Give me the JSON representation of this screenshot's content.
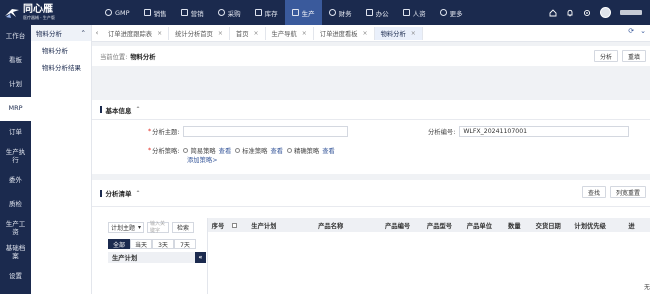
{
  "logo": {
    "title": "同心雁",
    "subtitle": "医疗器械 · 生产版"
  },
  "topnav": {
    "items": [
      {
        "label": "GMP",
        "icon": "settings-icon",
        "active": false
      },
      {
        "label": "销售",
        "icon": "sales-icon",
        "active": false
      },
      {
        "label": "营销",
        "icon": "marketing-icon",
        "active": false
      },
      {
        "label": "采购",
        "icon": "purchase-icon",
        "active": false
      },
      {
        "label": "库存",
        "icon": "inventory-icon",
        "active": false
      },
      {
        "label": "生产",
        "icon": "production-icon",
        "active": true
      },
      {
        "label": "财务",
        "icon": "finance-icon",
        "active": false
      },
      {
        "label": "办公",
        "icon": "office-icon",
        "active": false
      },
      {
        "label": "人资",
        "icon": "hr-icon",
        "active": false
      },
      {
        "label": "更多",
        "icon": "more-icon",
        "active": false
      }
    ]
  },
  "sidebar": {
    "items": [
      {
        "label": "工作台"
      },
      {
        "label": "看板"
      },
      {
        "label": "计划"
      },
      {
        "label": "MRP",
        "active": true
      },
      {
        "label": "订单"
      },
      {
        "label": "生产执行"
      },
      {
        "label": "委外"
      },
      {
        "label": "质检"
      },
      {
        "label": "生产工资"
      },
      {
        "label": "基础档案"
      },
      {
        "label": "设置"
      }
    ]
  },
  "subnav": {
    "header": "物料分析",
    "items": [
      "物料分析",
      "物料分析结果"
    ]
  },
  "tabs": {
    "items": [
      {
        "label": "订单进度跟踪表",
        "active": false
      },
      {
        "label": "统计分析首页",
        "active": false
      },
      {
        "label": "首页",
        "active": false
      },
      {
        "label": "生产导航",
        "active": false
      },
      {
        "label": "订单进度看板",
        "active": false
      },
      {
        "label": "物料分析",
        "active": true
      }
    ]
  },
  "breadcrumb": {
    "label": "当前位置:",
    "value": "物料分析"
  },
  "header_buttons": {
    "analyze": "分析",
    "reset": "重填"
  },
  "basic_info": {
    "title": "基本信息",
    "subject_label": "分析主题:",
    "subject_value": "",
    "number_label": "分析编号:",
    "number_value": "WLFX_20241107001",
    "strategy_label": "分析策略:",
    "strategies": [
      {
        "label": "简易策略",
        "link": "查看"
      },
      {
        "label": "标准策略",
        "link": "查看"
      },
      {
        "label": "精确策略",
        "link": "查看"
      }
    ],
    "add_strategy": "添加策略>"
  },
  "analysis_list": {
    "title": "分析清单",
    "find_button": "查找",
    "reset_columns_button": "列宽重置",
    "filter_select": "计划主题",
    "search_placeholder": "输入关键字",
    "search_button": "检索",
    "ranges": [
      "全部",
      "当天",
      "3天",
      "7天"
    ],
    "active_range": 0,
    "plan_header": "生产计划",
    "columns": [
      "序号",
      "",
      "生产计划",
      "产品名称",
      "产品编号",
      "产品型号",
      "产品单位",
      "数量",
      "交货日期",
      "计划优先级",
      "进"
    ],
    "footer": "无"
  }
}
